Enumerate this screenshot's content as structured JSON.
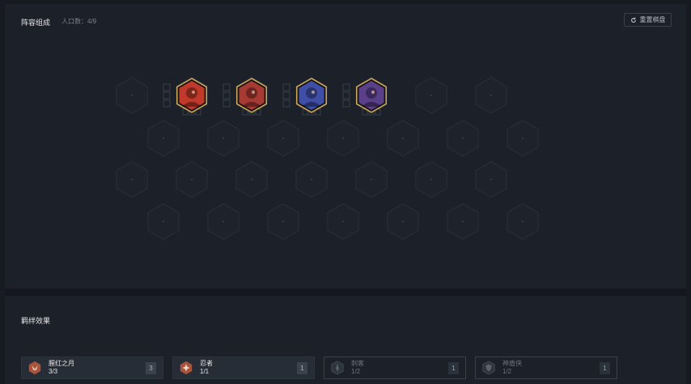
{
  "board": {
    "title": "阵容组成",
    "population": "人口数：4/9",
    "reset_label": "重置棋盘"
  },
  "champions": [
    {
      "icon": "champion-portrait-red-armored-icon",
      "color": "#c0392b"
    },
    {
      "icon": "champion-portrait-red-beast-icon",
      "color": "#a83a34"
    },
    {
      "icon": "champion-portrait-blue-knight-icon",
      "color": "#3f4fa8"
    },
    {
      "icon": "champion-portrait-purple-ninja-icon",
      "color": "#5a3f8a"
    }
  ],
  "traits_panel": {
    "title": "羁绊效果",
    "traits": [
      {
        "name": "腥红之月",
        "count": "3/3",
        "badge": "3",
        "active": true,
        "icon": "moon-emblem-icon"
      },
      {
        "name": "忍者",
        "count": "1/1",
        "badge": "1",
        "active": true,
        "icon": "shuriken-icon"
      },
      {
        "name": "刺客",
        "count": "1/2",
        "badge": "1",
        "active": false,
        "icon": "dagger-icon"
      },
      {
        "name": "神盾侠",
        "count": "1/2",
        "badge": "1",
        "active": false,
        "icon": "shield-icon"
      }
    ]
  },
  "colors": {
    "background": "#171b21",
    "panel": "#1b2029",
    "gold_border": "#c9a55a",
    "trait_active_icon": "#a8543c"
  }
}
